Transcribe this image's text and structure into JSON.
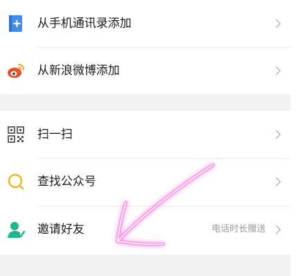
{
  "menu_group_1": {
    "items": [
      {
        "label": "从手机通讯录添加",
        "icon": "phone-contacts-icon"
      },
      {
        "label": "从新浪微博添加",
        "icon": "weibo-icon"
      }
    ]
  },
  "menu_group_2": {
    "items": [
      {
        "label": "扫一扫",
        "icon": "scan-icon"
      },
      {
        "label": "查找公众号",
        "icon": "search-icon"
      },
      {
        "label": "邀请好友",
        "icon": "invite-friend-icon",
        "hint": "电话时长赠送"
      }
    ]
  },
  "colors": {
    "contacts_blue": "#3d8ef0",
    "weibo_red": "#e6502a",
    "search_yellow": "#f2b51c",
    "invite_green": "#1fb68e",
    "annotation_pink": "#ff3fd0"
  }
}
